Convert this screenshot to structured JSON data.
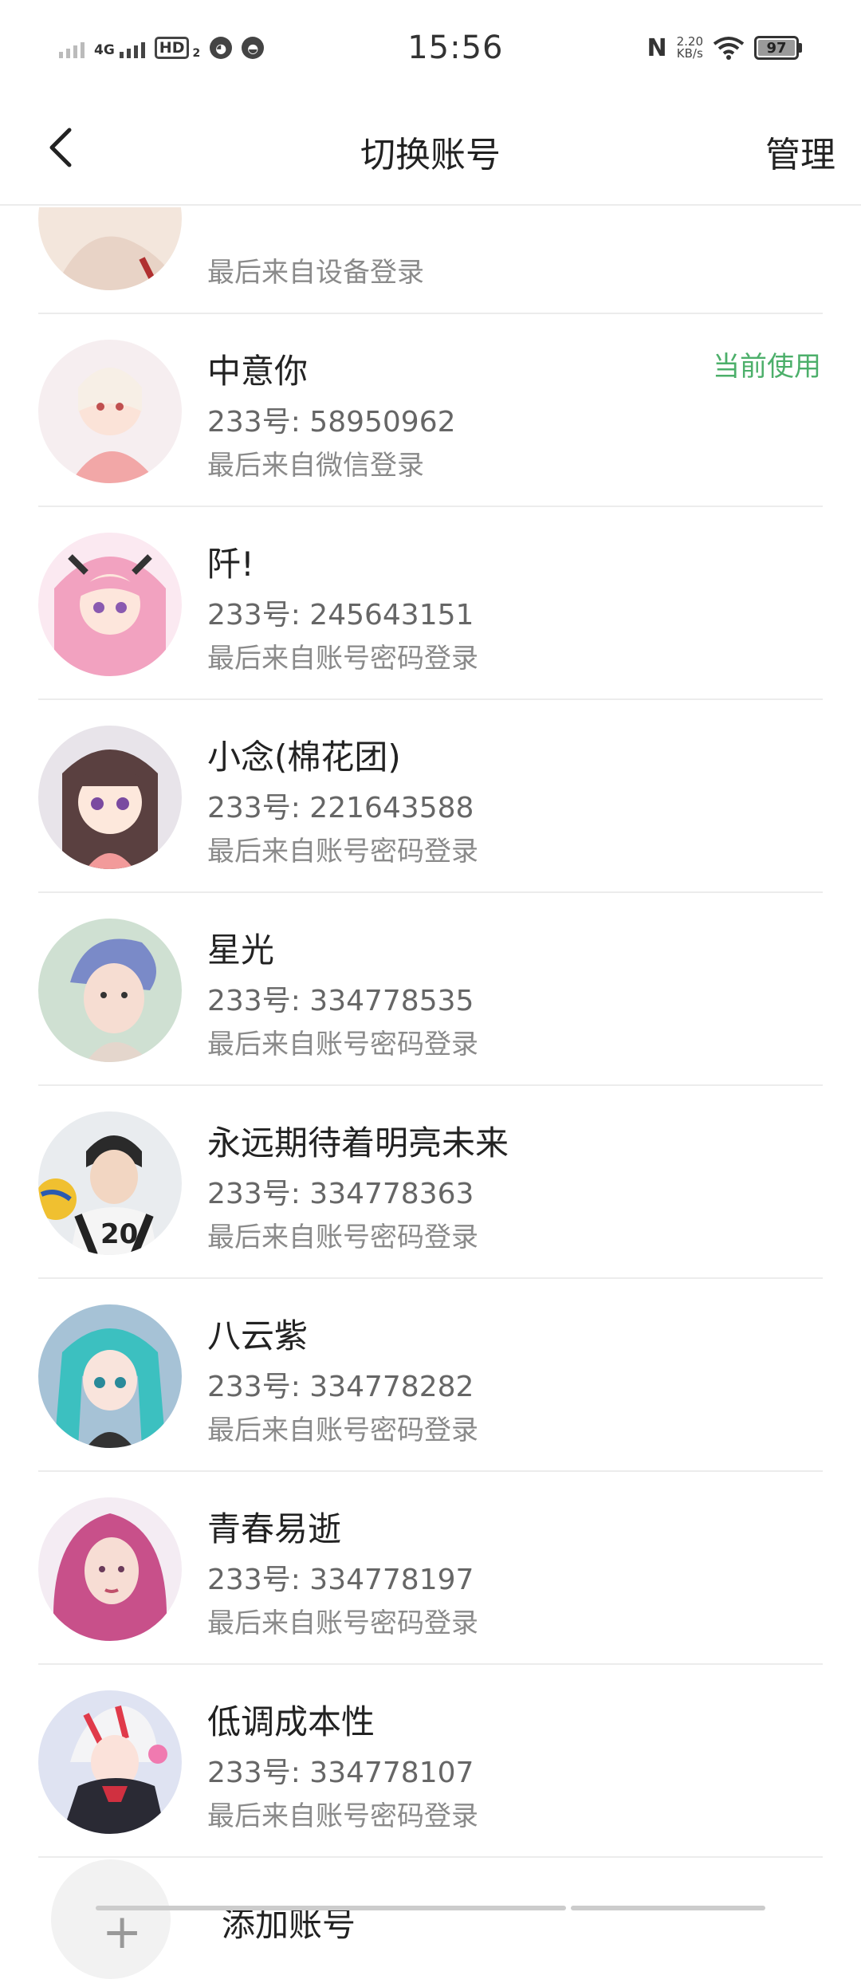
{
  "status_bar": {
    "network": "4G",
    "hd": "HD",
    "hd_sub": "2",
    "time": "15:56",
    "nfc": "N",
    "speed_value": "2.20",
    "speed_unit": "KB/s",
    "battery": "97"
  },
  "header": {
    "title": "切换账号",
    "manage_label": "管理"
  },
  "accounts": [
    {
      "name": "",
      "uid": "",
      "login": "最后来自设备登录",
      "current": ""
    },
    {
      "name": "中意你",
      "uid": "233号: 58950962",
      "login": "最后来自微信登录",
      "current": "当前使用"
    },
    {
      "name": "阡!",
      "uid": "233号: 245643151",
      "login": "最后来自账号密码登录",
      "current": ""
    },
    {
      "name": "小念(棉花团)",
      "uid": "233号: 221643588",
      "login": "最后来自账号密码登录",
      "current": ""
    },
    {
      "name": "星光",
      "uid": "233号: 334778535",
      "login": "最后来自账号密码登录",
      "current": ""
    },
    {
      "name": "永远期待着明亮未来",
      "uid": "233号: 334778363",
      "login": "最后来自账号密码登录",
      "current": ""
    },
    {
      "name": "八云紫",
      "uid": "233号: 334778282",
      "login": "最后来自账号密码登录",
      "current": ""
    },
    {
      "name": "青春易逝",
      "uid": "233号: 334778197",
      "login": "最后来自账号密码登录",
      "current": ""
    },
    {
      "name": "低调成本性",
      "uid": "233号: 334778107",
      "login": "最后来自账号密码登录",
      "current": ""
    }
  ],
  "add_account": {
    "label": "添加账号",
    "icon": "plus-icon"
  },
  "colors": {
    "current_badge": "#4caf6a",
    "divider": "#ececec"
  }
}
